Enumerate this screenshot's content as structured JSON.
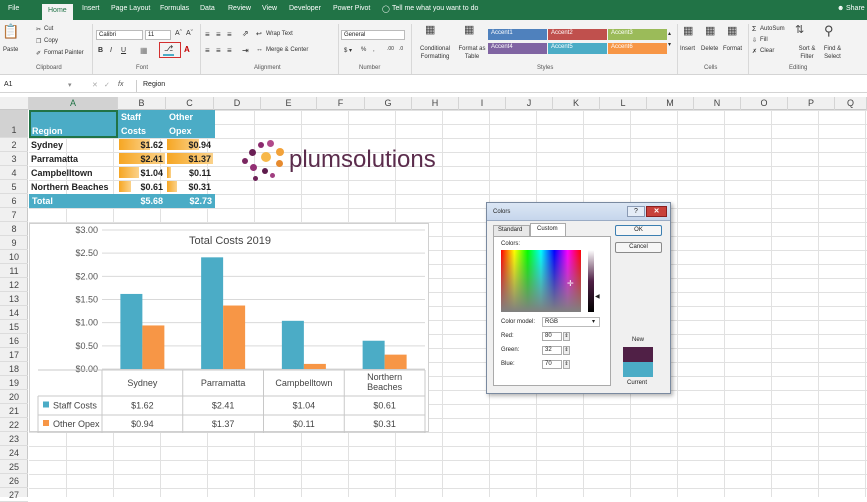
{
  "tabs": [
    "File",
    "Home",
    "Insert",
    "Page Layout",
    "Formulas",
    "Data",
    "Review",
    "View",
    "Developer",
    "Power Pivot"
  ],
  "tell_me": "Tell me what you want to do",
  "share": "Share",
  "ribbon": {
    "paste": "Paste",
    "cut": "Cut",
    "copy": "Copy",
    "format_painter": "Format Painter",
    "clipboard": "Clipboard",
    "font_name": "Calibri",
    "font_size": "11",
    "font": "Font",
    "wrap_text": "Wrap Text",
    "merge_center": "Merge & Center",
    "alignment": "Alignment",
    "number_format": "General",
    "number": "Number",
    "conditional_formatting": "Conditional Formatting",
    "format_as_table": "Format as Table",
    "styles": "Styles",
    "style_boxes": [
      {
        "label": "Accent1",
        "color": "#4f81bd"
      },
      {
        "label": "Accent2",
        "color": "#c0504d"
      },
      {
        "label": "Accent3",
        "color": "#9bbb59"
      },
      {
        "label": "Accent4",
        "color": "#8064a2"
      },
      {
        "label": "Accent5",
        "color": "#4bacc6"
      },
      {
        "label": "Accent6",
        "color": "#f79646"
      }
    ],
    "insert": "Insert",
    "delete": "Delete",
    "format": "Format",
    "cells": "Cells",
    "autosum": "AutoSum",
    "fill": "Fill",
    "clear": "Clear",
    "sort_filter": "Sort & Filter",
    "find_select": "Find & Select",
    "editing": "Editing"
  },
  "formula_bar": {
    "name_box": "A1",
    "fx": "fx",
    "content": "Region"
  },
  "columns": [
    "A",
    "B",
    "C",
    "D",
    "E",
    "F",
    "G",
    "H",
    "I",
    "J",
    "K",
    "L",
    "M",
    "N",
    "O",
    "P",
    "Q"
  ],
  "rows": [
    "1",
    "2",
    "3",
    "4",
    "5",
    "6",
    "7",
    "8",
    "9",
    "10",
    "11",
    "12",
    "13",
    "14",
    "15",
    "16",
    "17",
    "18",
    "19",
    "20",
    "21",
    "22",
    "23",
    "24",
    "25",
    "26",
    "27"
  ],
  "table": {
    "header": {
      "region": "Region",
      "staff_1": "Staff",
      "staff_2": "Costs",
      "other_1": "Other",
      "other_2": "Opex"
    },
    "rows": [
      {
        "region": "Sydney",
        "staff": "$1.62",
        "other": "$0.94",
        "staff_v": 1.62,
        "other_v": 0.94
      },
      {
        "region": "Parramatta",
        "staff": "$2.41",
        "other": "$1.37",
        "staff_v": 2.41,
        "other_v": 1.37
      },
      {
        "region": "Campbelltown",
        "staff": "$1.04",
        "other": "$0.11",
        "staff_v": 1.04,
        "other_v": 0.11
      },
      {
        "region": "Northern Beaches",
        "staff": "$0.61",
        "other": "$0.31",
        "staff_v": 0.61,
        "other_v": 0.31
      }
    ],
    "total": {
      "label": "Total",
      "staff": "$5.68",
      "other": "$2.73"
    }
  },
  "logo_text": "plumsolutions",
  "chart_data": {
    "type": "bar",
    "title": "Total Costs 2019",
    "categories": [
      "Sydney",
      "Parramatta",
      "Campbelltown",
      "Northern Beaches"
    ],
    "category_lines": [
      [
        "Sydney"
      ],
      [
        "Parramatta"
      ],
      [
        "Campbelltown"
      ],
      [
        "Northern",
        "Beaches"
      ]
    ],
    "series": [
      {
        "name": "Staff Costs",
        "values": [
          1.62,
          2.41,
          1.04,
          0.61
        ],
        "labels": [
          "$1.62",
          "$2.41",
          "$1.04",
          "$0.61"
        ],
        "color": "#4bacc6"
      },
      {
        "name": "Other Opex",
        "values": [
          0.94,
          1.37,
          0.11,
          0.31
        ],
        "labels": [
          "$0.94",
          "$1.37",
          "$0.11",
          "$0.31"
        ],
        "color": "#f79646"
      }
    ],
    "ylim": [
      0,
      3
    ],
    "yticks": [
      "$0.00",
      "$0.50",
      "$1.00",
      "$1.50",
      "$2.00",
      "$2.50",
      "$3.00"
    ],
    "ytick_values": [
      0,
      0.5,
      1,
      1.5,
      2,
      2.5,
      3
    ],
    "grid": true,
    "legend": "data-table"
  },
  "dialog": {
    "title": "Colors",
    "tab_standard": "Standard",
    "tab_custom": "Custom",
    "colors_label": "Colors:",
    "color_model_label": "Color model:",
    "color_model": "RGB",
    "red_label": "Red:",
    "red": "80",
    "green_label": "Green:",
    "green": "32",
    "blue_label": "Blue:",
    "blue": "70",
    "ok": "OK",
    "cancel": "Cancel",
    "new": "New",
    "current": "Current",
    "new_color": "#502046",
    "current_color": "#4bacc6"
  }
}
